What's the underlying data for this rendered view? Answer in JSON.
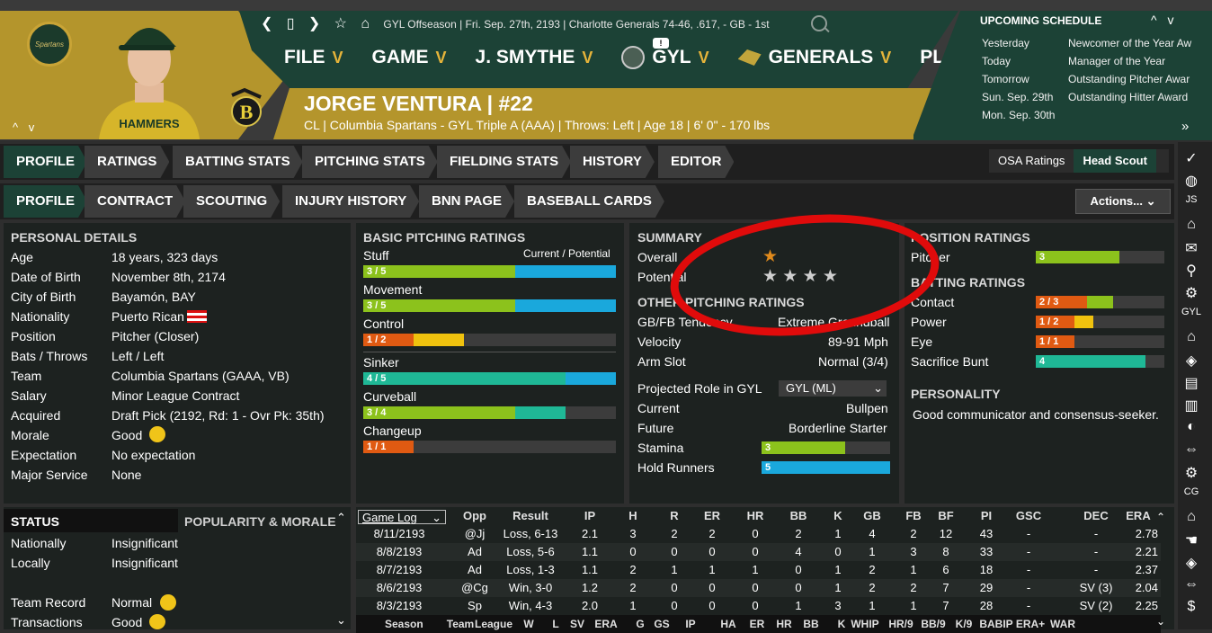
{
  "header": {
    "nav_icons": [
      "back-arrow-icon",
      "page-icon",
      "forward-arrow-icon",
      "star-icon",
      "home-icon"
    ],
    "league_status": "GYL Offseason",
    "date": "Fri. Sep. 27th, 2193",
    "team_record": "Charlotte Generals  74-46, .617, - GB - 1st",
    "logo_text": "Spartans",
    "left_arrows": "^ v",
    "menu": [
      {
        "label": "FILE"
      },
      {
        "label": "GAME"
      },
      {
        "label": "J. SMYTHE"
      },
      {
        "label": "GYL"
      },
      {
        "label": "GENERALS"
      },
      {
        "label": "PLAY"
      }
    ],
    "notification": "!",
    "player_name": "JORGE VENTURA  |  #22",
    "player_sub": "CL | Columbia Spartans - GYL Triple A (AAA)  |  Throws: Left  |  Age 18  |  6' 0\" - 170 lbs"
  },
  "schedule": {
    "title": "UPCOMING SCHEDULE",
    "arrows": "^ v",
    "rows": [
      {
        "day": "Yesterday",
        "event": "Newcomer of the Year Aw"
      },
      {
        "day": "Today",
        "event": "Manager of the Year"
      },
      {
        "day": "Tomorrow",
        "event": "Outstanding Pitcher Awar"
      },
      {
        "day": "Sun. Sep. 29th",
        "event": "Outstanding Hitter Award"
      },
      {
        "day": "Mon. Sep. 30th",
        "event": ""
      }
    ],
    "more": "»"
  },
  "tabs_row1": [
    "PROFILE",
    "RATINGS",
    "BATTING STATS",
    "PITCHING STATS",
    "FIELDING STATS",
    "HISTORY",
    "EDITOR"
  ],
  "tabs_row2": [
    "PROFILE",
    "CONTRACT",
    "SCOUTING",
    "INJURY HISTORY",
    "BNN PAGE",
    "BASEBALL CARDS"
  ],
  "osa_ratings": "OSA Ratings",
  "head_scout": "Head Scout",
  "actions": "Actions...",
  "personal": {
    "title": "PERSONAL DETAILS",
    "rows": [
      {
        "k": "Age",
        "v": "18 years, 323 days"
      },
      {
        "k": "Date of Birth",
        "v": "November 8th, 2174"
      },
      {
        "k": "City of Birth",
        "v": "Bayamón, BAY"
      },
      {
        "k": "Nationality",
        "v": "Puerto Rican"
      },
      {
        "k": "Position",
        "v": "Pitcher (Closer)"
      },
      {
        "k": "Bats / Throws",
        "v": "Left / Left"
      },
      {
        "k": "Team",
        "v": "Columbia Spartans (GAAA, VB)"
      },
      {
        "k": "Salary",
        "v": "Minor League Contract"
      },
      {
        "k": "Acquired",
        "v": "Draft Pick (2192, Rd: 1 - Ovr Pk: 35th)"
      },
      {
        "k": "Morale",
        "v": "Good"
      },
      {
        "k": "Expectation",
        "v": "No expectation"
      },
      {
        "k": "Major Service",
        "v": "None"
      }
    ]
  },
  "pitching": {
    "title": "BASIC PITCHING RATINGS",
    "cur_pot": "Current / Potential",
    "ratings": [
      {
        "name": "Stuff",
        "label": "3 / 5",
        "cur": 0.6,
        "pot": 1.0,
        "color": "#8cc21c",
        "pot_color": "#1aa8dc"
      },
      {
        "name": "Movement",
        "label": "3 / 5",
        "cur": 0.6,
        "pot": 1.0,
        "color": "#8cc21c",
        "pot_color": "#1aa8dc"
      },
      {
        "name": "Control",
        "label": "1 / 2",
        "cur": 0.2,
        "pot": 0.4,
        "color": "#e05a12",
        "pot_color": "#f0c20e"
      },
      {
        "name": "Sinker",
        "label": "4 / 5",
        "cur": 0.8,
        "pot": 1.0,
        "color": "#1fb896",
        "pot_color": "#1aa8dc"
      },
      {
        "name": "Curveball",
        "label": "3 / 4",
        "cur": 0.6,
        "pot": 0.8,
        "color": "#8cc21c",
        "pot_color": "#1fb896"
      },
      {
        "name": "Changeup",
        "label": "1 / 1",
        "cur": 0.2,
        "pot": 0.2,
        "color": "#e05a12",
        "pot_color": "#e05a12"
      }
    ]
  },
  "summary": {
    "title": "SUMMARY",
    "overall_label": "Overall",
    "overall_stars": "★",
    "potential_label": "Potential",
    "potential_stars": "★ ★ ★ ★",
    "other_title": "OTHER PITCHING RATINGS",
    "other": [
      {
        "k": "GB/FB Tendency",
        "v": "Extreme Groundball"
      },
      {
        "k": "Velocity",
        "v": "89-91 Mph"
      },
      {
        "k": "Arm Slot",
        "v": "Normal (3/4)"
      }
    ],
    "role_label": "Projected Role in GYL",
    "role_select": "GYL (ML)",
    "current_label": "Current",
    "current_value": "Bullpen",
    "future_label": "Future",
    "future_value": "Borderline Starter",
    "stamina_label": "Stamina",
    "stamina_value": "3",
    "stamina_fill": 0.65,
    "hold_label": "Hold Runners",
    "hold_value": "5",
    "hold_fill": 1.0
  },
  "position": {
    "title": "POSITION RATINGS",
    "pitcher_label": "Pitcher",
    "pitcher_value": "3",
    "pitcher_fill": 0.65,
    "batting_title": "BATTING RATINGS",
    "batting": [
      {
        "name": "Contact",
        "label": "2 / 3",
        "cur": 0.4,
        "pot": 0.6,
        "color": "#e05a12",
        "pot_color": "#8cc21c"
      },
      {
        "name": "Power",
        "label": "1 / 2",
        "cur": 0.3,
        "pot": 0.45,
        "color": "#e05a12",
        "pot_color": "#f0c20e"
      },
      {
        "name": "Eye",
        "label": "1 / 1",
        "cur": 0.3,
        "pot": 0.3,
        "color": "#e05a12",
        "pot_color": "#e05a12"
      },
      {
        "name": "Sacrifice Bunt",
        "label": "4",
        "cur": 0.85,
        "pot": 0.85,
        "color": "#1fb896",
        "pot_color": "#1fb896"
      }
    ],
    "personality_title": "PERSONALITY",
    "personality": "Good communicator and consensus-seeker."
  },
  "status": {
    "tab1": "STATUS",
    "tab2": "POPULARITY & MORALE",
    "rows": [
      {
        "k": "Nationally",
        "v": "Insignificant"
      },
      {
        "k": "Locally",
        "v": "Insignificant"
      },
      {
        "k": "Team Record",
        "v": "Normal"
      },
      {
        "k": "Transactions",
        "v": "Good"
      }
    ]
  },
  "gamelog": {
    "select": "Game Log",
    "headers": [
      "Opp",
      "Result",
      "IP",
      "H",
      "R",
      "ER",
      "HR",
      "BB",
      "K",
      "GB",
      "FB",
      "BF",
      "PI",
      "GSC",
      "DEC",
      "ERA"
    ],
    "rows": [
      [
        "8/11/2193",
        "@Jj",
        "Loss, 6-13",
        "2.1",
        "3",
        "2",
        "2",
        "0",
        "2",
        "1",
        "4",
        "2",
        "12",
        "43",
        "-",
        "-",
        "2.78"
      ],
      [
        "8/8/2193",
        "Ad",
        "Loss, 5-6",
        "1.1",
        "0",
        "0",
        "0",
        "0",
        "4",
        "0",
        "1",
        "3",
        "8",
        "33",
        "-",
        "-",
        "2.21"
      ],
      [
        "8/7/2193",
        "Ad",
        "Loss, 1-3",
        "1.1",
        "2",
        "1",
        "1",
        "1",
        "0",
        "1",
        "2",
        "1",
        "6",
        "18",
        "-",
        "-",
        "2.37"
      ],
      [
        "8/6/2193",
        "@Cg",
        "Win, 3-0",
        "1.2",
        "2",
        "0",
        "0",
        "0",
        "0",
        "1",
        "2",
        "2",
        "7",
        "29",
        "-",
        "SV (3)",
        "2.04"
      ],
      [
        "8/3/2193",
        "Sp",
        "Win, 4-3",
        "2.0",
        "1",
        "0",
        "0",
        "0",
        "1",
        "3",
        "1",
        "1",
        "7",
        "28",
        "-",
        "SV (2)",
        "2.25"
      ]
    ],
    "footer": [
      "Season",
      "Team",
      "League",
      "W",
      "L",
      "SV",
      "ERA",
      "G",
      "GS",
      "IP",
      "HA",
      "ER",
      "HR",
      "BB",
      "K",
      "WHIP",
      "HR/9",
      "BB/9",
      "K/9",
      "BABIP",
      "ERA+",
      "WAR"
    ]
  },
  "right_bar": [
    "check-icon",
    "globe-icon",
    "JS",
    "home-icon",
    "mail-icon",
    "search-icon",
    "gear-icon",
    "GYL",
    "home-icon",
    "target-icon",
    "card-icon",
    "chart-icon",
    "ball-icon",
    "swap-icon",
    "gear-icon",
    "CG",
    "home-icon",
    "hand-icon",
    "target-icon",
    "swap-icon",
    "dollar-icon"
  ],
  "colors": {
    "accent_gold": "#b4952c",
    "accent_green": "#1c4236",
    "annotation_red": "#e00b0b"
  }
}
